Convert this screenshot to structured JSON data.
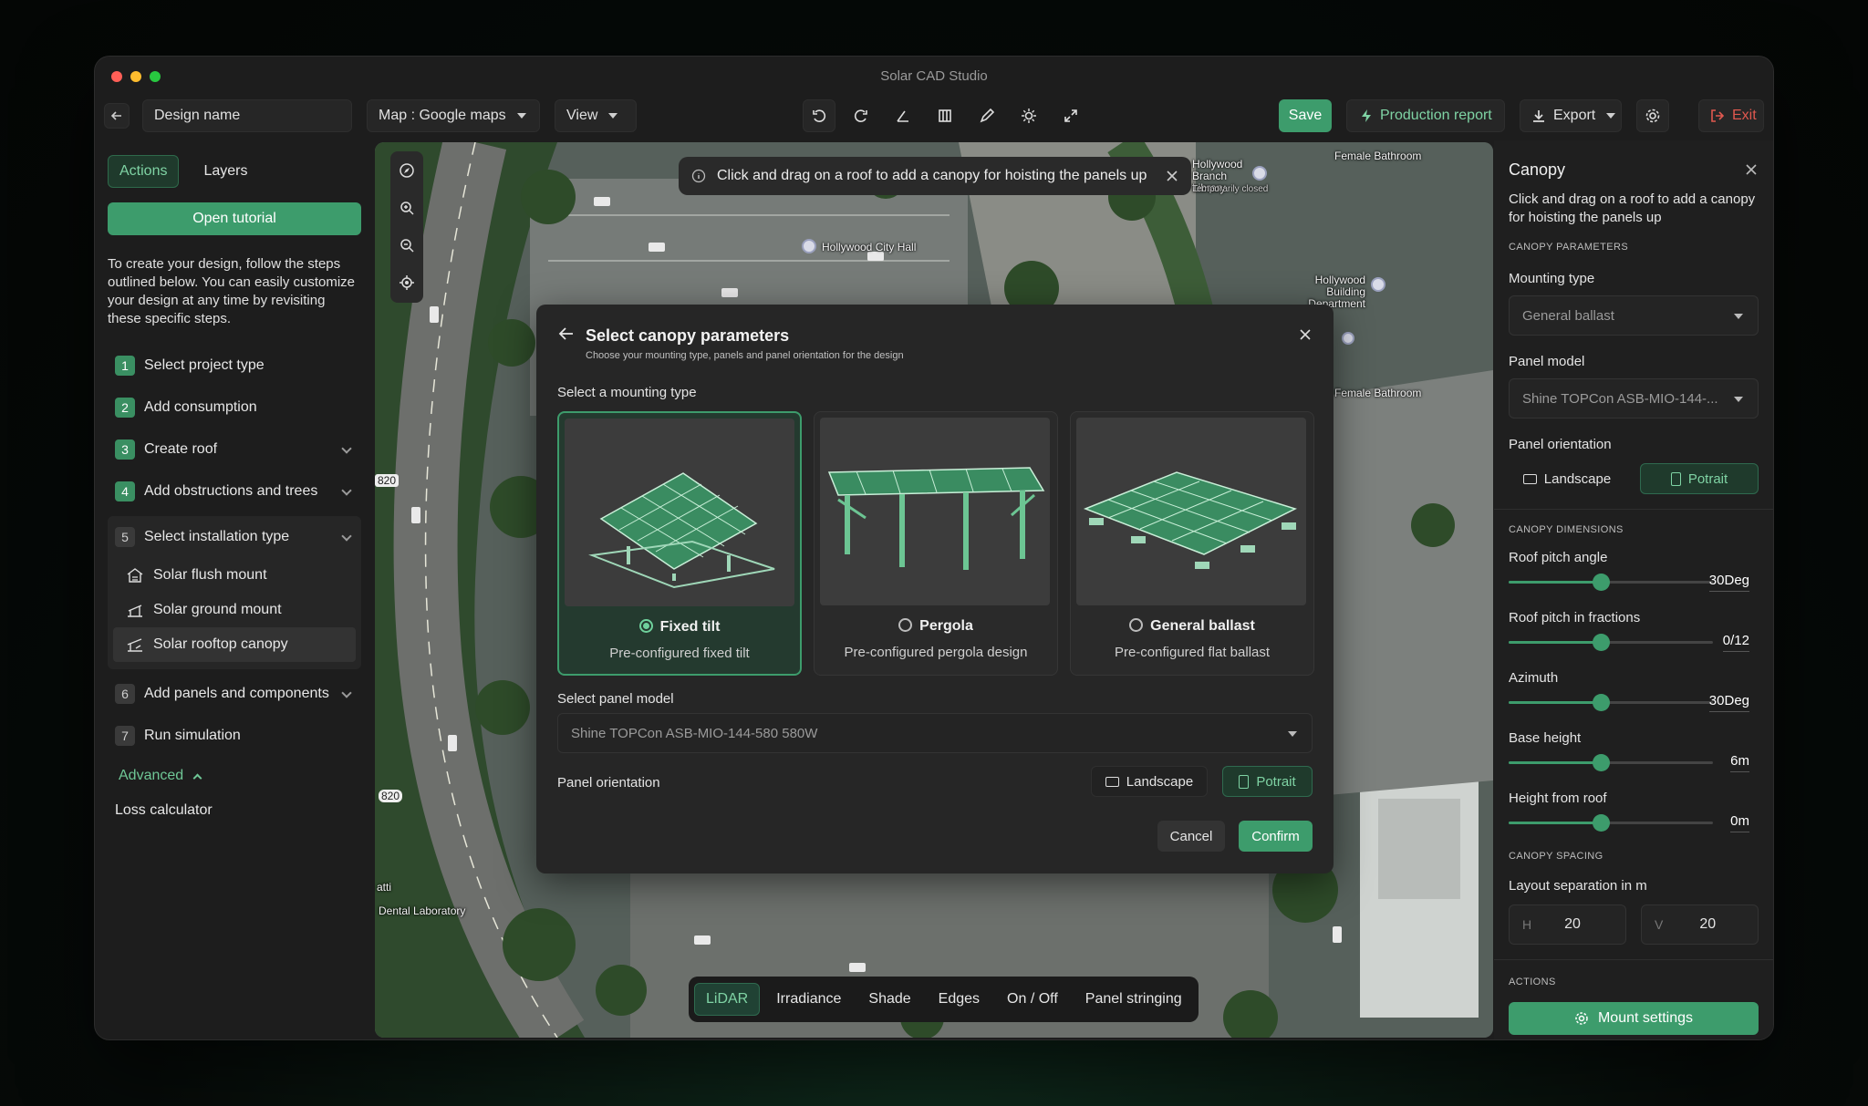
{
  "app": {
    "title": "Solar CAD Studio"
  },
  "toolbar": {
    "design_name": "Design name",
    "map_select": "Map : Google maps",
    "view_select": "View",
    "save": "Save",
    "production_report": "Production report",
    "export": "Export",
    "exit": "Exit"
  },
  "left": {
    "tabs": [
      "Actions",
      "Layers"
    ],
    "tutorial": "Open tutorial",
    "intro": "To create your design, follow the steps outlined below. You can easily customize your design at any time by revisiting these specific steps.",
    "steps": [
      {
        "num": "1",
        "label": "Select project type"
      },
      {
        "num": "2",
        "label": "Add consumption"
      },
      {
        "num": "3",
        "label": "Create roof"
      },
      {
        "num": "4",
        "label": "Add obstructions and trees"
      },
      {
        "num": "5",
        "label": "Select installation type"
      },
      {
        "num": "6",
        "label": "Add panels and components"
      },
      {
        "num": "7",
        "label": "Run simulation"
      }
    ],
    "install_types": [
      "Solar flush mount",
      "Solar ground mount",
      "Solar rooftop canopy"
    ],
    "advanced": "Advanced",
    "loss_calculator": "Loss calculator"
  },
  "map": {
    "info": "Click and drag on a roof to add a canopy for hoisting the panels up",
    "labels": {
      "city_hall": "Hollywood City Hall",
      "library": "Hollywood Branch Library",
      "library_status": "Temporarily closed",
      "bathroom1": "Female Bathroom",
      "bathroom2": "Female Bathroom",
      "building_dept": "Hollywood Building Department",
      "dental": "Dental Laboratory",
      "road_820a": "820",
      "road_820b": "820",
      "atti": "atti"
    },
    "bottom_tabs": [
      "LiDAR",
      "Irradiance",
      "Shade",
      "Edges",
      "On / Off",
      "Panel stringing"
    ]
  },
  "modal": {
    "title": "Select canopy parameters",
    "subtitle": "Choose your mounting type, panels and panel orientation for the design",
    "mounting_heading": "Select a mounting type",
    "cards": [
      {
        "name": "Fixed tilt",
        "desc": "Pre-configured fixed tilt"
      },
      {
        "name": "Pergola",
        "desc": "Pre-configured pergola design"
      },
      {
        "name": "General ballast",
        "desc": "Pre-configured flat ballast"
      }
    ],
    "panel_heading": "Select panel model",
    "panel_value": "Shine TOPCon ASB-MIO-144-580 580W",
    "orientation_label": "Panel orientation",
    "landscape": "Landscape",
    "potrait": "Potrait",
    "cancel": "Cancel",
    "confirm": "Confirm"
  },
  "right": {
    "title": "Canopy",
    "description": "Click and drag on a roof to add a canopy for hoisting the panels up",
    "params_section": "CANOPY PARAMETERS",
    "mounting_label": "Mounting type",
    "mounting_value": "General ballast",
    "panel_label": "Panel model",
    "panel_value": "Shine TOPCon ASB-MIO-144-...",
    "orientation_label": "Panel orientation",
    "landscape": "Landscape",
    "potrait": "Potrait",
    "dims_section": "CANOPY DIMENSIONS",
    "sliders": [
      {
        "label": "Roof pitch angle",
        "value": "30Deg",
        "fraction": 0.45
      },
      {
        "label": "Roof pitch in fractions",
        "value": "0/12",
        "fraction": 0.45
      },
      {
        "label": "Azimuth",
        "value": "30Deg",
        "fraction": 0.45
      },
      {
        "label": "Base height",
        "value": "6m",
        "fraction": 0.45
      },
      {
        "label": "Height from roof",
        "value": "0m",
        "fraction": 0.45
      }
    ],
    "spacing_section": "CANOPY SPACING",
    "layout_label": "Layout  separation in m",
    "h_label": "H",
    "h_value": "20",
    "v_label": "V",
    "v_value": "20",
    "actions_section": "ACTIONS",
    "mount_settings": "Mount settings"
  },
  "colors": {
    "accent": "#3d9c6c",
    "exit": "#e0584f"
  }
}
